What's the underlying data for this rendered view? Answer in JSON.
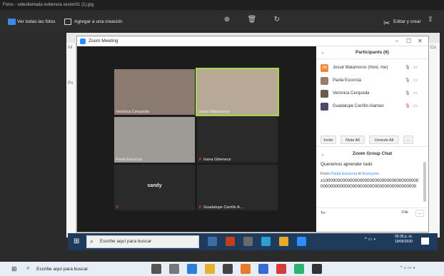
{
  "photos": {
    "title": "Fotos - videollamada evidencia sesion01 (1).jpg",
    "see_all": "Ver todas las fotos",
    "add_creation": "Agregar a una creación",
    "edit_create": "Editar y crear"
  },
  "frame_left_labels": [
    "Ini",
    "Po"
  ],
  "frame_right_labels": [
    "Co"
  ],
  "zoom": {
    "title": "Zoom Meeting",
    "tiles": [
      {
        "name": "Verónica Cerqueda",
        "mute": false,
        "center": ""
      },
      {
        "name": "Josue Matamoros",
        "mute": false,
        "center": ""
      },
      {
        "name": "Paola Escorcia",
        "mute": false,
        "center": ""
      },
      {
        "name": "Ivana Gibenece",
        "mute": true,
        "center": ""
      },
      {
        "name": "",
        "mute": true,
        "center": "sandy"
      },
      {
        "name": "Guadalupe Carrillo A...",
        "mute": true,
        "center": ""
      }
    ],
    "participants_title": "Participants (6)",
    "participants": [
      {
        "name": "Josué Matamoros (Host, me)",
        "initials": "JM",
        "mic_muted": false,
        "cam_off": false
      },
      {
        "name": "Paola Escorcia",
        "initials": "",
        "mic_muted": false,
        "cam_off": false
      },
      {
        "name": "Verónica Cerqueda",
        "initials": "",
        "mic_muted": false,
        "cam_off": false
      },
      {
        "name": "Guadalupe Carrillo Alaman",
        "initials": "",
        "mic_muted": true,
        "cam_off": true
      }
    ],
    "buttons": {
      "invite": "Invite",
      "mute_all": "Mute All",
      "unmute_all": "Unmute All",
      "more": "..."
    },
    "chat_title": "Zoom Group Chat",
    "chat_msg1": "Queremos aprender todo",
    "chat_from_prefix": "From",
    "chat_from_name": "Paola Escorcia",
    "chat_from_mid": "to",
    "chat_from_to": "Everyone",
    "chat_msg2": "x100000000000000000000000000000000000000000000000000000000000000000000000000000",
    "to_label": "To:",
    "file_label": "File",
    "file_more": "..."
  },
  "inner_taskbar": {
    "search_placeholder": "Escribe aquí para buscar",
    "clock_time": "05:35 p. m.",
    "clock_date": "19/05/2020"
  },
  "outer_taskbar": {
    "search_placeholder": "Escribe aquí para buscar"
  },
  "colors": {
    "zoom_blue": "#2d8cff",
    "active_speaker": "#a6d84a",
    "muted_red": "#e23a3a"
  }
}
